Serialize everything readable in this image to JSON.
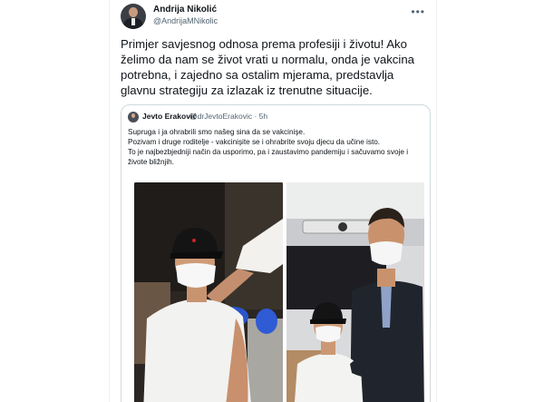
{
  "tweet": {
    "author_name": "Andrija Nikolić",
    "author_handle": "@AndrijaMNikolic",
    "more_icon": "more-horizontal-icon",
    "text": "Primjer savjesnog odnosa prema profesiji i životu! Ako želimo da nam se život vrati u normalu, onda je vakcina potrebna, i zajedno sa ostalim mjerama, predstavlja glavnu strategiju za izlazak iz trenutne situacije."
  },
  "quote": {
    "author_name": "Jevto Eraković",
    "author_handle": "@drJevtoErakovic · 5h",
    "lines": [
      "Supruga i ja ohrabrili smo našeg sina da se vakcinişe.",
      "Pozivam i druge roditelje - vakcinişite se i ohrabrite svoju djecu da učine isto.",
      "To je najbezbjedniji način da usporimo, pa i zaustavimo pandemiju i sačuvamo svoje i živote bližnjih."
    ],
    "photos": [
      "photo-vaccination",
      "photo-father-son"
    ]
  },
  "colors": {
    "text": "#0f1419",
    "secondary": "#536471",
    "border": "#cfd9de",
    "glove_blue": "#2a54c9"
  }
}
